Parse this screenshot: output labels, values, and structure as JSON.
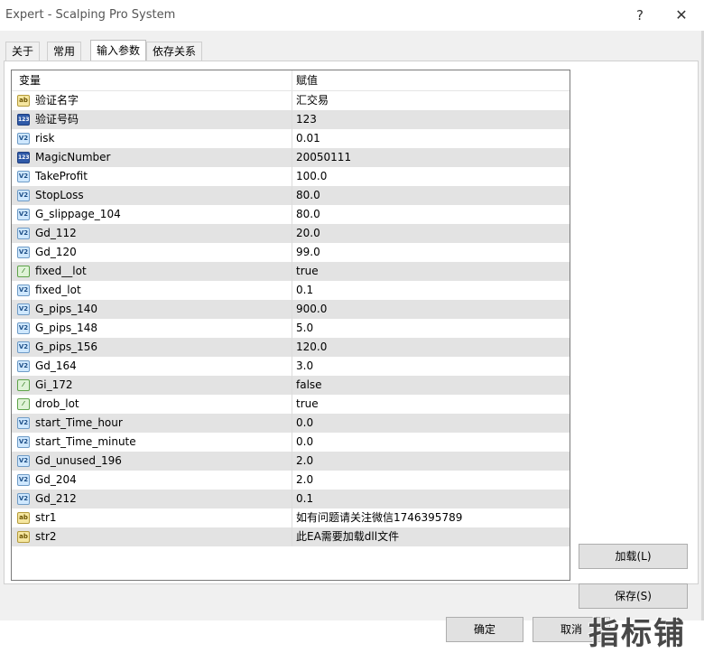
{
  "window": {
    "title": "Expert - Scalping Pro System",
    "help_glyph": "?",
    "close_glyph": "✕"
  },
  "tabs": [
    {
      "label": "关于",
      "active": false
    },
    {
      "label": "常用",
      "active": false
    },
    {
      "label": "输入参数",
      "active": true
    },
    {
      "label": "依存关系",
      "active": false
    }
  ],
  "grid": {
    "header_variable": "变量",
    "header_value": "赋值",
    "rows": [
      {
        "name": "验证名字",
        "value": "汇交易",
        "icon": "string-icon",
        "icon_text": "ab"
      },
      {
        "name": "验证号码",
        "value": "123",
        "icon": "integer-icon",
        "icon_text": "123"
      },
      {
        "name": "risk",
        "value": "0.01",
        "icon": "double-icon",
        "icon_text": "V2"
      },
      {
        "name": "MagicNumber",
        "value": "20050111",
        "icon": "integer-icon",
        "icon_text": "123"
      },
      {
        "name": "TakeProfit",
        "value": "100.0",
        "icon": "double-icon",
        "icon_text": "V2"
      },
      {
        "name": "StopLoss",
        "value": "80.0",
        "icon": "double-icon",
        "icon_text": "V2"
      },
      {
        "name": "G_slippage_104",
        "value": "80.0",
        "icon": "double-icon",
        "icon_text": "V2"
      },
      {
        "name": "Gd_112",
        "value": "20.0",
        "icon": "double-icon",
        "icon_text": "V2"
      },
      {
        "name": "Gd_120",
        "value": "99.0",
        "icon": "double-icon",
        "icon_text": "V2"
      },
      {
        "name": "fixed__lot",
        "value": "true",
        "icon": "bool-icon",
        "icon_text": "⁄"
      },
      {
        "name": "fixed_lot",
        "value": "0.1",
        "icon": "double-icon",
        "icon_text": "V2"
      },
      {
        "name": "G_pips_140",
        "value": "900.0",
        "icon": "double-icon",
        "icon_text": "V2"
      },
      {
        "name": "G_pips_148",
        "value": "5.0",
        "icon": "double-icon",
        "icon_text": "V2"
      },
      {
        "name": "G_pips_156",
        "value": "120.0",
        "icon": "double-icon",
        "icon_text": "V2"
      },
      {
        "name": "Gd_164",
        "value": "3.0",
        "icon": "double-icon",
        "icon_text": "V2"
      },
      {
        "name": "Gi_172",
        "value": "false",
        "icon": "bool-icon",
        "icon_text": "⁄"
      },
      {
        "name": "drob_lot",
        "value": "true",
        "icon": "bool-icon",
        "icon_text": "⁄"
      },
      {
        "name": "start_Time_hour",
        "value": "0.0",
        "icon": "double-icon",
        "icon_text": "V2"
      },
      {
        "name": "start_Time_minute",
        "value": "0.0",
        "icon": "double-icon",
        "icon_text": "V2"
      },
      {
        "name": "Gd_unused_196",
        "value": "2.0",
        "icon": "double-icon",
        "icon_text": "V2"
      },
      {
        "name": "Gd_204",
        "value": "2.0",
        "icon": "double-icon",
        "icon_text": "V2"
      },
      {
        "name": "Gd_212",
        "value": "0.1",
        "icon": "double-icon",
        "icon_text": "V2"
      },
      {
        "name": "str1",
        "value": "如有问题请关注微信1746395789",
        "icon": "string-icon",
        "icon_text": "ab"
      },
      {
        "name": "str2",
        "value": "此EA需要加载dll文件",
        "icon": "string-icon",
        "icon_text": "ab"
      }
    ]
  },
  "buttons": {
    "load": "加载(L)",
    "save": "保存(S)",
    "ok": "确定",
    "cancel": "取消"
  },
  "watermark": {
    "text": "指标铺"
  }
}
